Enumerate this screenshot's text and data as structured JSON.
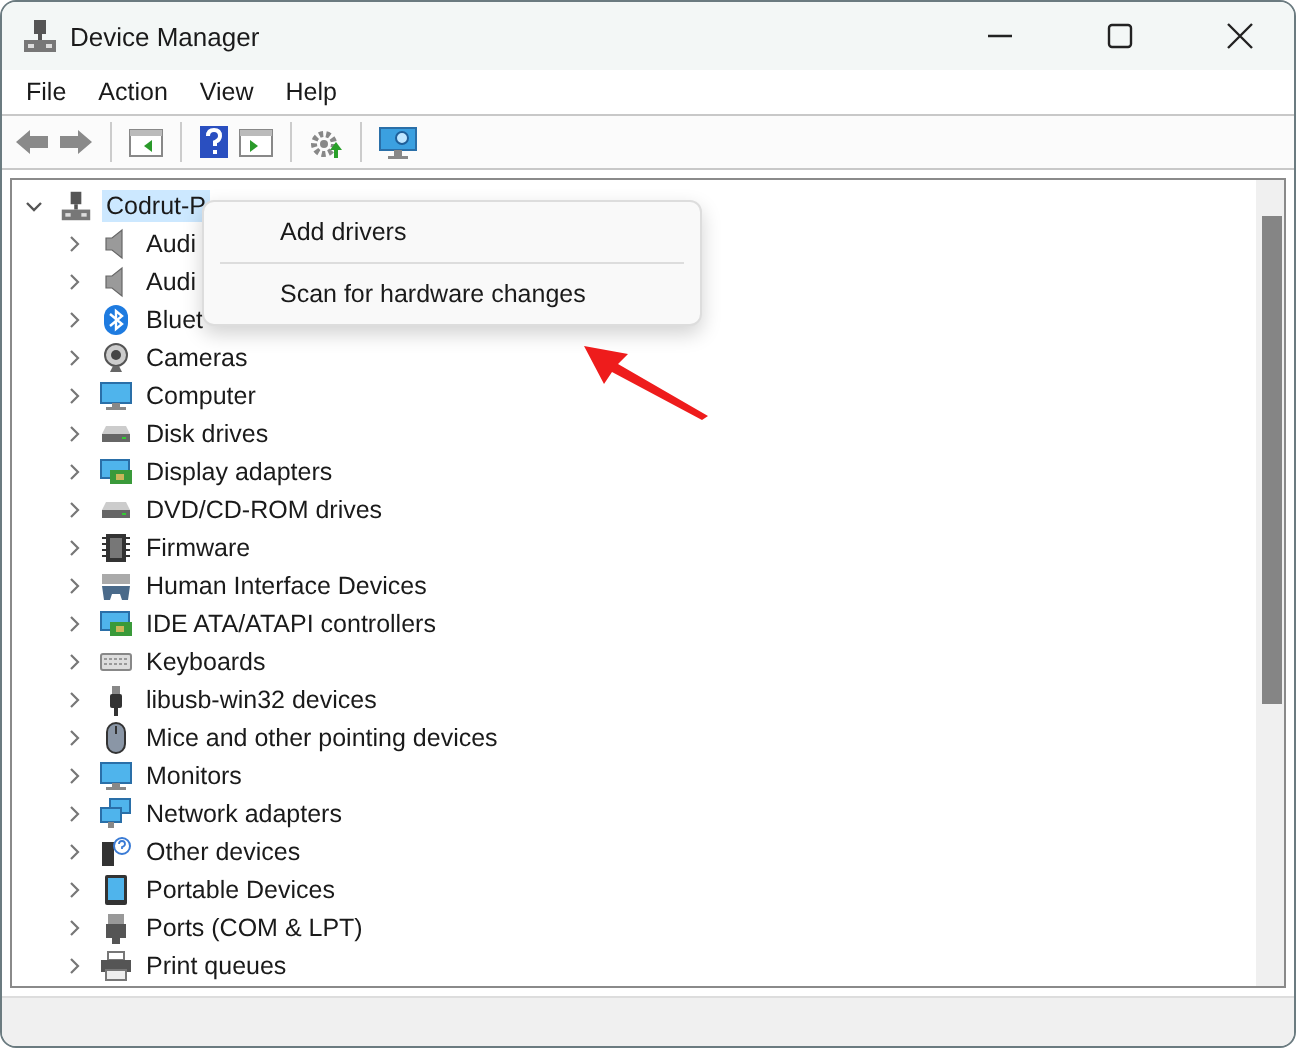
{
  "window": {
    "title": "Device Manager"
  },
  "menu_bar": [
    "File",
    "Action",
    "View",
    "Help"
  ],
  "tree": {
    "label": "Codrut-P",
    "expanded": true,
    "selected": true,
    "children": [
      {
        "label": "Audi",
        "kind": "speaker",
        "expanded": false
      },
      {
        "label": "Audi",
        "kind": "speaker",
        "expanded": false
      },
      {
        "label": "Bluet",
        "kind": "bluetooth",
        "expanded": false
      },
      {
        "label": "Cameras",
        "kind": "camera",
        "expanded": false
      },
      {
        "label": "Computer",
        "kind": "monitor",
        "expanded": false
      },
      {
        "label": "Disk drives",
        "kind": "drive",
        "expanded": false
      },
      {
        "label": "Display adapters",
        "kind": "card",
        "expanded": false
      },
      {
        "label": "DVD/CD-ROM drives",
        "kind": "drive",
        "expanded": false
      },
      {
        "label": "Firmware",
        "kind": "chip",
        "expanded": false
      },
      {
        "label": "Human Interface Devices",
        "kind": "hid",
        "expanded": false
      },
      {
        "label": "IDE ATA/ATAPI controllers",
        "kind": "card",
        "expanded": false
      },
      {
        "label": "Keyboards",
        "kind": "keyboard",
        "expanded": false
      },
      {
        "label": "libusb-win32 devices",
        "kind": "usb",
        "expanded": false
      },
      {
        "label": "Mice and other pointing devices",
        "kind": "mouse",
        "expanded": false
      },
      {
        "label": "Monitors",
        "kind": "monitor",
        "expanded": false
      },
      {
        "label": "Network adapters",
        "kind": "network",
        "expanded": false
      },
      {
        "label": "Other devices",
        "kind": "unknown",
        "expanded": false
      },
      {
        "label": "Portable Devices",
        "kind": "tablet",
        "expanded": false
      },
      {
        "label": "Ports (COM & LPT)",
        "kind": "port",
        "expanded": false
      },
      {
        "label": "Print queues",
        "kind": "printer",
        "expanded": false
      }
    ]
  },
  "context_menu": {
    "items": [
      "Add drivers",
      "Scan for hardware changes"
    ]
  }
}
